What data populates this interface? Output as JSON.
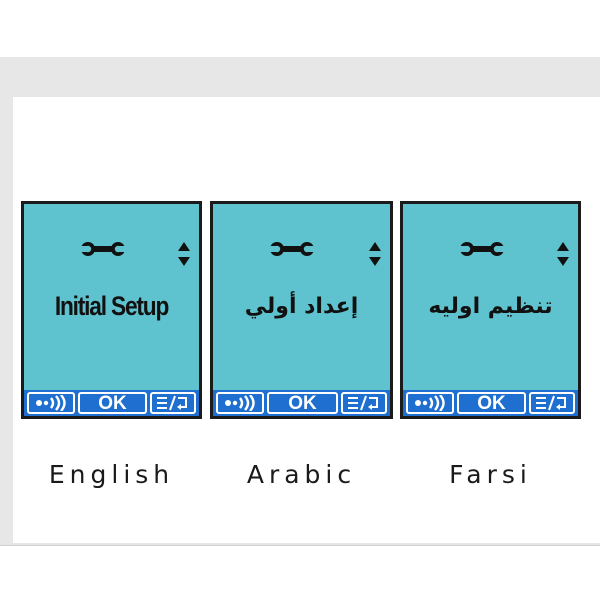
{
  "screens": [
    {
      "language": "English",
      "title": "Initial Setup",
      "softkeys": {
        "ok_label": "OK"
      }
    },
    {
      "language": "Arabic",
      "title": "إعداد أولي",
      "softkeys": {
        "ok_label": "OK"
      }
    },
    {
      "language": "Farsi",
      "title": "تنظیم اولیه",
      "softkeys": {
        "ok_label": "OK"
      }
    }
  ],
  "icons": {
    "header_icon": "wrench-icon",
    "scroll_icon": "up-down-arrows-icon",
    "left_softkey_icon": "voice-signal-icon",
    "right_softkey_icon": "menu-return-icon"
  },
  "colors": {
    "screen_background": "#5fc3cf",
    "softkey_bar": "#1f6fd1",
    "bezel": "#1b1b1b",
    "text": "#111111"
  }
}
